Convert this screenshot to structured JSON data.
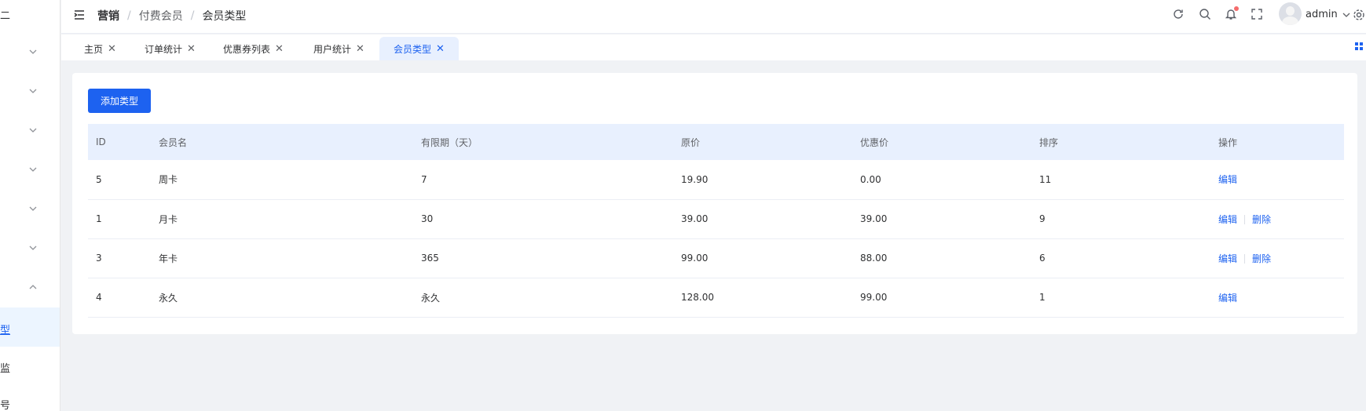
{
  "sidebar": {
    "logo_fragment": "二",
    "sub_items": [
      "型",
      "监",
      "号"
    ]
  },
  "header": {
    "breadcrumb": [
      "营销",
      "付费会员",
      "会员类型"
    ],
    "user": "admin"
  },
  "tabs": [
    {
      "label": "主页",
      "active": false
    },
    {
      "label": "订单统计",
      "active": false
    },
    {
      "label": "优惠券列表",
      "active": false
    },
    {
      "label": "用户统计",
      "active": false
    },
    {
      "label": "会员类型",
      "active": true
    }
  ],
  "toolbar": {
    "add_label": "添加类型"
  },
  "table": {
    "columns": [
      "ID",
      "会员名",
      "有限期（天）",
      "原价",
      "优惠价",
      "排序",
      "操作"
    ],
    "rows": [
      {
        "id": "5",
        "name": "周卡",
        "days": "7",
        "price": "19.90",
        "discount": "0.00",
        "sort": "11",
        "actions": [
          "编辑"
        ]
      },
      {
        "id": "1",
        "name": "月卡",
        "days": "30",
        "price": "39.00",
        "discount": "39.00",
        "sort": "9",
        "actions": [
          "编辑",
          "删除"
        ]
      },
      {
        "id": "3",
        "name": "年卡",
        "days": "365",
        "price": "99.00",
        "discount": "88.00",
        "sort": "6",
        "actions": [
          "编辑",
          "删除"
        ]
      },
      {
        "id": "4",
        "name": "永久",
        "days": "永久",
        "price": "128.00",
        "discount": "99.00",
        "sort": "1",
        "actions": [
          "编辑"
        ]
      }
    ]
  },
  "colors": {
    "primary": "#1d62f0",
    "header_bg": "#e8f0fe",
    "badge": "#f56c6c"
  },
  "icons": [
    "hamburger-icon",
    "refresh-icon",
    "search-icon",
    "bell-icon",
    "fullscreen-icon",
    "chevron-down-icon",
    "settings-icon",
    "grid-icon",
    "close-icon"
  ]
}
